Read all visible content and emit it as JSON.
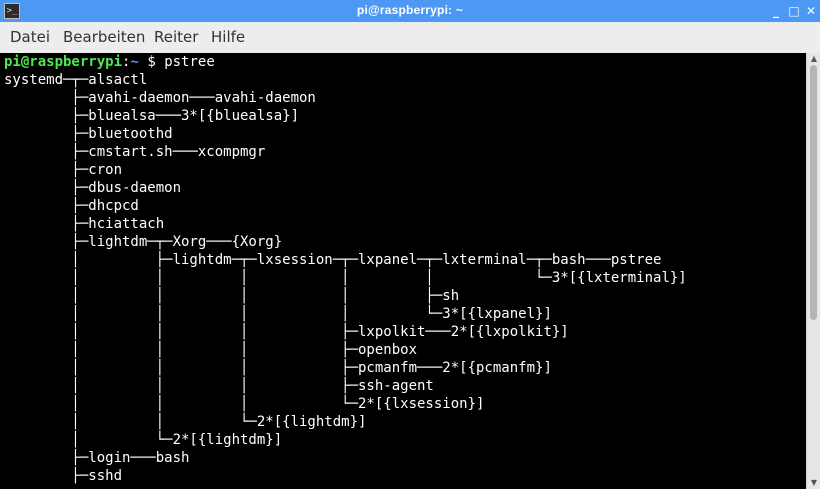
{
  "window": {
    "title": "pi@raspberrypi: ~"
  },
  "icons": {
    "app": "terminal-icon",
    "minimize": "minimize-icon",
    "maximize": "maximize-icon",
    "close": "close-icon"
  },
  "colors": {
    "titlebar": "#4d98f5",
    "terminal_bg": "#000000",
    "prompt_user": "#4ee84e",
    "prompt_path": "#5c8cff",
    "text": "#ffffff"
  },
  "menu": {
    "items": [
      "Datei",
      "Bearbeiten",
      "Reiter",
      "Hilfe"
    ]
  },
  "terminal": {
    "prompt": {
      "user": "pi@raspberrypi",
      "sep": ":",
      "path": "~",
      "symbol": "$",
      "command": "pstree"
    },
    "lines": [
      "systemd─┬─alsactl",
      "        ├─avahi-daemon───avahi-daemon",
      "        ├─bluealsa───3*[{bluealsa}]",
      "        ├─bluetoothd",
      "        ├─cmstart.sh───xcompmgr",
      "        ├─cron",
      "        ├─dbus-daemon",
      "        ├─dhcpcd",
      "        ├─hciattach",
      "        ├─lightdm─┬─Xorg───{Xorg}",
      "        │         ├─lightdm─┬─lxsession─┬─lxpanel─┬─lxterminal─┬─bash───pstree",
      "        │         │         │           │         │            └─3*[{lxterminal}]",
      "        │         │         │           │         ├─sh",
      "        │         │         │           │         └─3*[{lxpanel}]",
      "        │         │         │           ├─lxpolkit───2*[{lxpolkit}]",
      "        │         │         │           ├─openbox",
      "        │         │         │           ├─pcmanfm───2*[{pcmanfm}]",
      "        │         │         │           ├─ssh-agent",
      "        │         │         │           └─2*[{lxsession}]",
      "        │         │         └─2*[{lightdm}]",
      "        │         └─2*[{lightdm}]",
      "        ├─login───bash",
      "        ├─sshd"
    ]
  }
}
